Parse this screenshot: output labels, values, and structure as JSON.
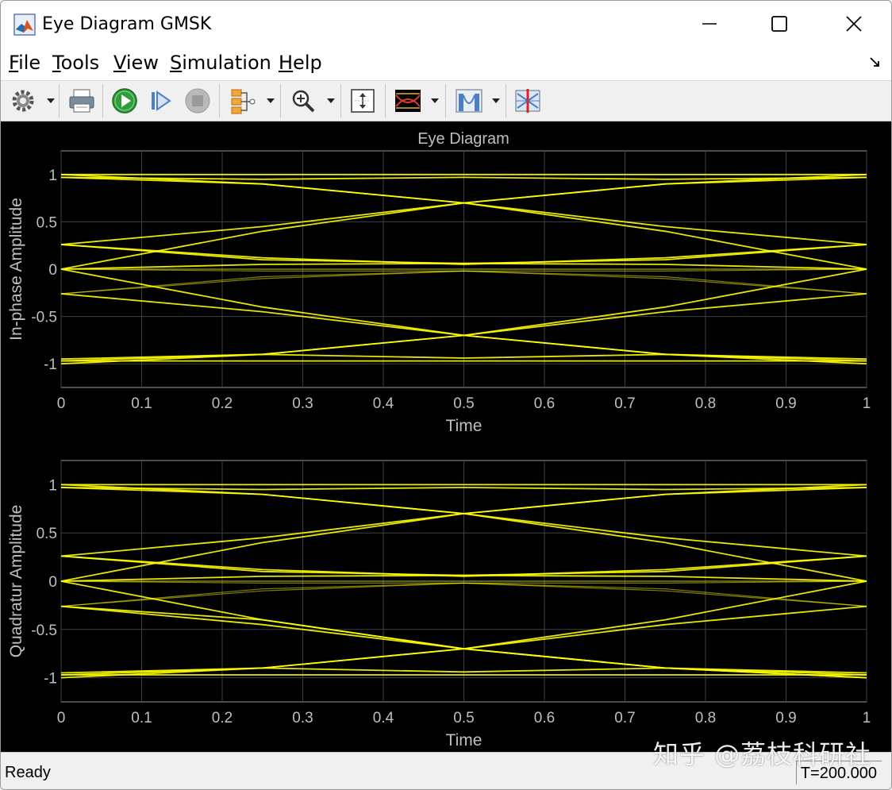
{
  "window": {
    "title": "Eye Diagram GMSK",
    "controls": [
      "minimize",
      "maximize",
      "close"
    ]
  },
  "menu": {
    "items": [
      {
        "label": "File"
      },
      {
        "label": "Tools"
      },
      {
        "label": "View"
      },
      {
        "label": "Simulation"
      },
      {
        "label": "Help"
      }
    ]
  },
  "toolbar": {
    "icons": [
      "gear-icon",
      "print-icon",
      "run-icon",
      "step-forward-icon",
      "stop-icon",
      "signal-hierarchy-icon",
      "zoom-in-icon",
      "scale-axes-icon",
      "eye-diagram-icon",
      "histogram-icon",
      "cursor-measurement-icon"
    ]
  },
  "colors": {
    "trace": "#ffff00",
    "plot_background": "#000000",
    "axes_text": "#bfbfbf",
    "grid": "#404040"
  },
  "status": {
    "text": "Ready",
    "time": "T=200.000"
  },
  "watermark": "知乎 @荔枝科研社",
  "chart_data": [
    {
      "type": "line",
      "title": "Eye Diagram",
      "xlabel": "Time",
      "ylabel": "In-phase Amplitude",
      "xlim": [
        0,
        1
      ],
      "ylim": [
        -1.25,
        1.25
      ],
      "xticks": [
        "0",
        "0.1",
        "0.2",
        "0.3",
        "0.4",
        "0.5",
        "0.6",
        "0.7",
        "0.8",
        "0.9",
        "1"
      ],
      "yticks": [
        "1",
        "0.5",
        "0",
        "-0.5",
        "-1"
      ],
      "grid": true,
      "series": [
        {
          "x": [
            0,
            0.25,
            0.5,
            0.75,
            1
          ],
          "y": [
            1.0,
            1.0,
            1.0,
            1.0,
            1.0
          ]
        },
        {
          "x": [
            0,
            0.25,
            0.5,
            0.75,
            1
          ],
          "y": [
            0.97,
            0.95,
            0.97,
            0.95,
            0.97
          ]
        },
        {
          "x": [
            0,
            0.25,
            0.5,
            0.75,
            1
          ],
          "y": [
            -0.97,
            -0.97,
            -0.97,
            -0.97,
            -0.97
          ]
        },
        {
          "x": [
            0,
            0.25,
            0.5,
            0.75,
            1
          ],
          "y": [
            -0.95,
            -0.9,
            -0.94,
            -0.9,
            -0.95
          ]
        },
        {
          "x": [
            0,
            0.25,
            0.5,
            0.75,
            1
          ],
          "y": [
            0.97,
            0.9,
            0.7,
            0.45,
            0.26
          ]
        },
        {
          "x": [
            0,
            0.25,
            0.5,
            0.75,
            1
          ],
          "y": [
            0.26,
            0.45,
            0.7,
            0.9,
            0.97
          ]
        },
        {
          "x": [
            0,
            0.25,
            0.5,
            0.75,
            1
          ],
          "y": [
            0.0,
            0.4,
            0.7,
            0.9,
            1.0
          ]
        },
        {
          "x": [
            0,
            0.25,
            0.5,
            0.75,
            1
          ],
          "y": [
            1.0,
            0.9,
            0.7,
            0.4,
            0.0
          ]
        },
        {
          "x": [
            0,
            0.25,
            0.5,
            0.75,
            1
          ],
          "y": [
            -0.97,
            -0.9,
            -0.7,
            -0.45,
            -0.26
          ]
        },
        {
          "x": [
            0,
            0.25,
            0.5,
            0.75,
            1
          ],
          "y": [
            -0.26,
            -0.45,
            -0.7,
            -0.9,
            -0.97
          ]
        },
        {
          "x": [
            0,
            0.25,
            0.5,
            0.75,
            1
          ],
          "y": [
            0.0,
            -0.4,
            -0.7,
            -0.9,
            -1.0
          ]
        },
        {
          "x": [
            0,
            0.25,
            0.5,
            0.75,
            1
          ],
          "y": [
            -1.0,
            -0.9,
            -0.7,
            -0.4,
            0.0
          ]
        },
        {
          "x": [
            0,
            0.25,
            0.5,
            0.75,
            1
          ],
          "y": [
            0.26,
            0.12,
            0.05,
            0.12,
            0.26
          ]
        },
        {
          "x": [
            0,
            0.25,
            0.5,
            0.75,
            1
          ],
          "y": [
            0.0,
            0.05,
            0.06,
            0.1,
            0.26
          ]
        },
        {
          "x": [
            0,
            0.25,
            0.5,
            0.75,
            1
          ],
          "y": [
            0.26,
            0.1,
            0.06,
            0.05,
            0.0
          ]
        },
        {
          "x": [
            0,
            0.25,
            0.5,
            0.75,
            1
          ],
          "y": [
            0.0,
            0.0,
            0.0,
            0.0,
            0.0
          ]
        },
        {
          "x": [
            0,
            0.25,
            0.5,
            0.75,
            1
          ],
          "y": [
            -0.26,
            -0.08,
            -0.02,
            -0.08,
            -0.26
          ]
        },
        {
          "x": [
            0,
            0.25,
            0.5,
            0.75,
            1
          ],
          "y": [
            0.0,
            -0.02,
            -0.02,
            -0.1,
            -0.26
          ]
        },
        {
          "x": [
            0,
            0.25,
            0.5,
            0.75,
            1
          ],
          "y": [
            -0.26,
            -0.1,
            -0.02,
            -0.02,
            0.0
          ]
        }
      ]
    },
    {
      "type": "line",
      "title": "",
      "xlabel": "Time",
      "ylabel": "Quadratur Amplitude",
      "xlim": [
        0,
        1
      ],
      "ylim": [
        -1.25,
        1.25
      ],
      "xticks": [
        "0",
        "0.1",
        "0.2",
        "0.3",
        "0.4",
        "0.5",
        "0.6",
        "0.7",
        "0.8",
        "0.9",
        "1"
      ],
      "yticks": [
        "1",
        "0.5",
        "0",
        "-0.5",
        "-1"
      ],
      "grid": true,
      "series": [
        {
          "x": [
            0,
            0.25,
            0.5,
            0.75,
            1
          ],
          "y": [
            1.0,
            1.0,
            1.0,
            1.0,
            1.0
          ]
        },
        {
          "x": [
            0,
            0.25,
            0.5,
            0.75,
            1
          ],
          "y": [
            0.97,
            0.95,
            0.97,
            0.95,
            0.97
          ]
        },
        {
          "x": [
            0,
            0.25,
            0.5,
            0.75,
            1
          ],
          "y": [
            -0.97,
            -0.97,
            -0.97,
            -0.97,
            -0.97
          ]
        },
        {
          "x": [
            0,
            0.25,
            0.5,
            0.75,
            1
          ],
          "y": [
            -0.95,
            -0.9,
            -0.94,
            -0.9,
            -0.95
          ]
        },
        {
          "x": [
            0,
            0.25,
            0.5,
            0.75,
            1
          ],
          "y": [
            0.97,
            0.9,
            0.7,
            0.45,
            0.26
          ]
        },
        {
          "x": [
            0,
            0.25,
            0.5,
            0.75,
            1
          ],
          "y": [
            0.26,
            0.45,
            0.7,
            0.9,
            0.97
          ]
        },
        {
          "x": [
            0,
            0.25,
            0.5,
            0.75,
            1
          ],
          "y": [
            0.0,
            0.4,
            0.7,
            0.9,
            1.0
          ]
        },
        {
          "x": [
            0,
            0.25,
            0.5,
            0.75,
            1
          ],
          "y": [
            1.0,
            0.9,
            0.7,
            0.4,
            0.0
          ]
        },
        {
          "x": [
            0,
            0.25,
            0.5,
            0.75,
            1
          ],
          "y": [
            -0.97,
            -0.9,
            -0.7,
            -0.45,
            -0.26
          ]
        },
        {
          "x": [
            0,
            0.25,
            0.5,
            0.75,
            1
          ],
          "y": [
            -0.26,
            -0.45,
            -0.7,
            -0.9,
            -0.97
          ]
        },
        {
          "x": [
            0,
            0.25,
            0.5,
            0.75,
            1
          ],
          "y": [
            0.0,
            -0.4,
            -0.7,
            -0.9,
            -1.0
          ]
        },
        {
          "x": [
            0,
            0.25,
            0.5,
            0.75,
            1
          ],
          "y": [
            -1.0,
            -0.9,
            -0.7,
            -0.4,
            0.0
          ]
        },
        {
          "x": [
            0,
            0.25,
            0.5,
            0.75,
            1
          ],
          "y": [
            0.26,
            0.12,
            0.05,
            0.12,
            0.26
          ]
        },
        {
          "x": [
            0,
            0.25,
            0.5,
            0.75,
            1
          ],
          "y": [
            0.0,
            0.05,
            0.06,
            0.1,
            0.26
          ]
        },
        {
          "x": [
            0,
            0.25,
            0.5,
            0.75,
            1
          ],
          "y": [
            0.26,
            0.1,
            0.06,
            0.05,
            0.0
          ]
        },
        {
          "x": [
            0,
            0.25,
            0.5,
            0.75,
            1
          ],
          "y": [
            0.0,
            0.0,
            0.0,
            0.0,
            0.0
          ]
        },
        {
          "x": [
            0,
            0.25,
            0.5,
            0.75,
            1
          ],
          "y": [
            -0.26,
            -0.08,
            -0.02,
            -0.08,
            -0.26
          ]
        },
        {
          "x": [
            0,
            0.25,
            0.5,
            0.75,
            1
          ],
          "y": [
            0.0,
            -0.02,
            -0.02,
            -0.1,
            -0.26
          ]
        },
        {
          "x": [
            0,
            0.25,
            0.5,
            0.75,
            1
          ],
          "y": [
            -0.26,
            -0.1,
            -0.02,
            -0.02,
            0.0
          ]
        },
        {
          "x": [
            0,
            0.25,
            0.5,
            0.75,
            1
          ],
          "y": [
            -0.26,
            -0.4,
            -0.7,
            -0.9,
            -1.0
          ]
        }
      ]
    }
  ]
}
